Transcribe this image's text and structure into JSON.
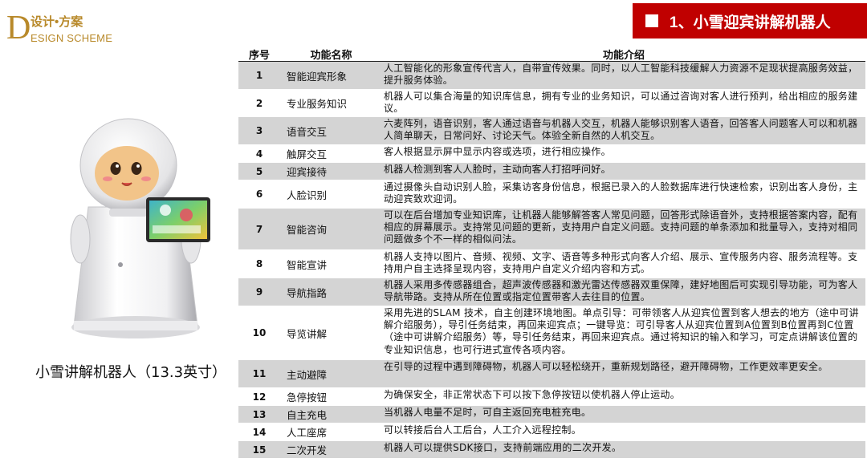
{
  "logo": {
    "letter": "D",
    "top": "设计•方案",
    "bottom": "ESIGN SCHEME"
  },
  "banner": {
    "title": "1、小雪迎宾讲解机器人"
  },
  "robot": {
    "caption": "小雪讲解机器人（13.3英寸）"
  },
  "table": {
    "headers": {
      "no": "序号",
      "name": "功能名称",
      "desc": "功能介绍"
    },
    "rows": [
      {
        "no": "1",
        "name": "智能迎宾形象",
        "desc": "人工智能化的形象宣传代言人，自带宣传效果。同时，以人工智能科技缓解人力资源不足现状提高服务效益，提升服务体验。"
      },
      {
        "no": "2",
        "name": "专业服务知识",
        "desc": "机器人可以集合海量的知识库信息，拥有专业的业务知识，可以通过咨询对客人进行预判，给出相应的服务建议。"
      },
      {
        "no": "3",
        "name": "语音交互",
        "desc": "六麦阵列，语音识别，客人通过语音与机器人交互，机器人能够识别客人语音，回答客人问题客人可以和机器人简单聊天，日常问好、讨论天气。体验全新自然的人机交互。"
      },
      {
        "no": "4",
        "name": "触屏交互",
        "desc": "客人根据显示屏中显示内容或选项，进行相应操作。"
      },
      {
        "no": "5",
        "name": "迎宾接待",
        "desc": "机器人检测到客人人脸时，主动向客人打招呼问好。"
      },
      {
        "no": "6",
        "name": "人脸识别",
        "desc": "通过摄像头自动识别人脸，采集访客身份信息，根据已录入的人脸数据库进行快速检索，识别出客人身份，主动迎宾致欢迎词。"
      },
      {
        "no": "7",
        "name": "智能咨询",
        "desc": "可以在后台增加专业知识库，让机器人能够解答客人常见问题，回答形式除语音外，支持根据答案内容，配有相应的屏幕展示。支持常见问题的更新，支持用户自定义问题。支持问题的单条添加和批量导入，支持对相同问题做多个不一样的相似问法。"
      },
      {
        "no": "8",
        "name": "智能宣讲",
        "desc": "机器人支持以图片、音频、视频、文字、语音等多种形式向客人介绍、展示、宣传服务内容、服务流程等。支持用户自主选择呈现内容，支持用户自定义介绍内容和方式。"
      },
      {
        "no": "9",
        "name": "导航指路",
        "desc": "机器人采用多传感器组合，超声波传感器和激光雷达传感器双重保障，建好地图后可实现引导功能，可为客人导航带路。支持从所在位置或指定位置带客人去往目的位置。"
      },
      {
        "no": "10",
        "name": "导览讲解",
        "desc": "采用先进的SLAM 技术，自主创建环境地图。单点引导：可带领客人从迎宾位置到客人想去的地方（途中可讲解介绍服务），导引任务结束，再回来迎宾点；一键导览：可引导客人从迎宾位置到A位置到B位置再到C位置（途中可讲解介绍服务）等，导引任务结束，再回来迎宾点。通过将知识的输入和学习，可定点讲解该位置的专业知识信息，也可行进式宣传各项内容。"
      },
      {
        "no": "11",
        "name": "主动避障",
        "desc": "在引导的过程中遇到障碍物，机器人可以轻松绕开，重新规划路径，避开障碍物，工作更效率更安全。"
      },
      {
        "no": "12",
        "name": "急停按钮",
        "desc": "为确保安全，非正常状态下可以按下急停按钮以使机器人停止运动。"
      },
      {
        "no": "13",
        "name": "自主充电",
        "desc": "当机器人电量不足时，可自主返回充电桩充电。"
      },
      {
        "no": "14",
        "name": "人工座席",
        "desc": "可以转接后台人工后台，人工介入远程控制。"
      },
      {
        "no": "15",
        "name": "二次开发",
        "desc": "机器人可以提供SDK接口，支持前端应用的二次开发。"
      }
    ]
  }
}
